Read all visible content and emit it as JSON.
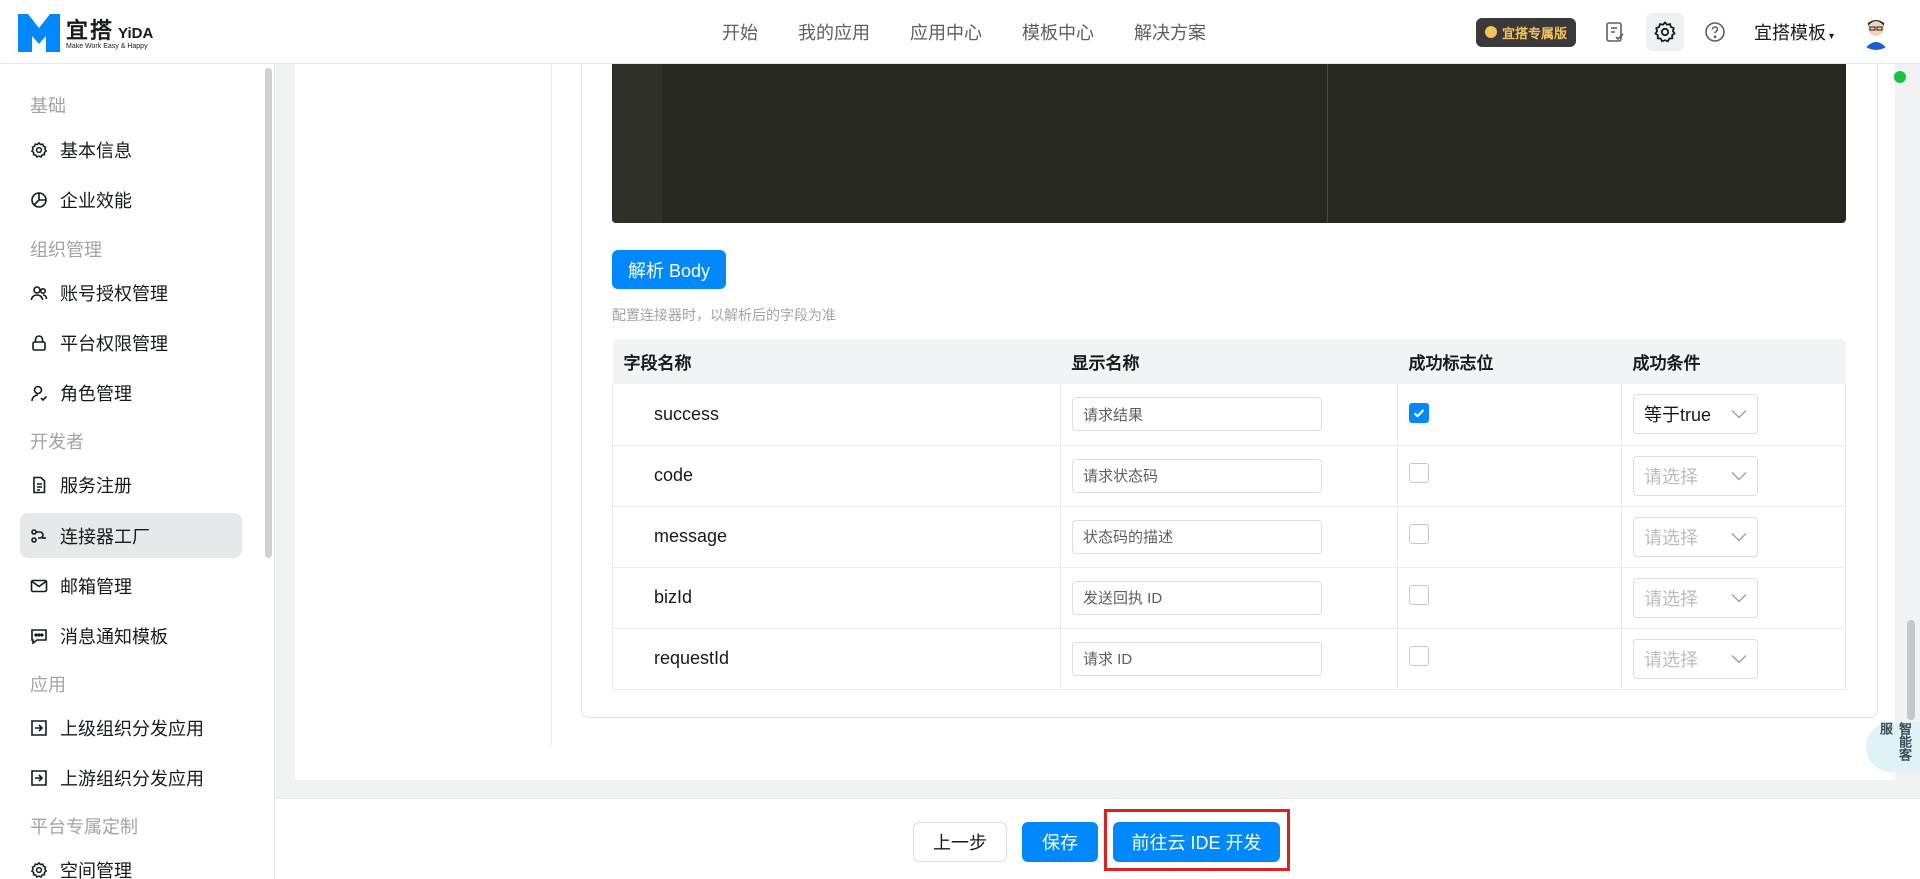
{
  "brand": {
    "name_cn": "宜搭",
    "name_en": "YiDA",
    "tagline": "Make Work Easy & Happy"
  },
  "nav": [
    "开始",
    "我的应用",
    "应用中心",
    "模板中心",
    "解决方案"
  ],
  "header_right": {
    "pro_badge": "宜搭专属版",
    "org_name": "宜搭模板"
  },
  "sidebar": {
    "groups": [
      {
        "title": "基础",
        "items": [
          {
            "label": "基本信息",
            "icon": "gear-icon"
          },
          {
            "label": "企业效能",
            "icon": "pie-chart-icon"
          }
        ]
      },
      {
        "title": "组织管理",
        "items": [
          {
            "label": "账号授权管理",
            "icon": "users-icon"
          },
          {
            "label": "平台权限管理",
            "icon": "lock-icon"
          },
          {
            "label": "角色管理",
            "icon": "user-role-icon"
          }
        ]
      },
      {
        "title": "开发者",
        "items": [
          {
            "label": "服务注册",
            "icon": "document-icon"
          },
          {
            "label": "连接器工厂",
            "icon": "connector-icon"
          },
          {
            "label": "邮箱管理",
            "icon": "mail-icon"
          },
          {
            "label": "消息通知模板",
            "icon": "message-icon"
          }
        ]
      },
      {
        "title": "应用",
        "items": [
          {
            "label": "上级组织分发应用",
            "icon": "enter-icon"
          },
          {
            "label": "上游组织分发应用",
            "icon": "enter-icon"
          }
        ]
      },
      {
        "title": "平台专属定制",
        "items": [
          {
            "label": "空间管理",
            "icon": "gear-icon"
          }
        ]
      }
    ],
    "active": "连接器工厂"
  },
  "content": {
    "parse_button": "解析 Body",
    "tip": "配置连接器时，以解析后的字段为准",
    "table": {
      "headers": [
        "字段名称",
        "显示名称",
        "成功标志位",
        "成功条件"
      ],
      "rows": [
        {
          "field": "success",
          "display": "请求结果",
          "flag": true,
          "condition": "等于true"
        },
        {
          "field": "code",
          "display": "请求状态码",
          "flag": false,
          "condition": "请选择"
        },
        {
          "field": "message",
          "display": "状态码的描述",
          "flag": false,
          "condition": "请选择"
        },
        {
          "field": "bizId",
          "display": "发送回执 ID",
          "flag": false,
          "condition": "请选择"
        },
        {
          "field": "requestId",
          "display": "请求 ID",
          "flag": false,
          "condition": "请选择"
        }
      ]
    }
  },
  "footer": {
    "prev": "上一步",
    "save": "保存",
    "ide": "前往云 IDE 开发"
  },
  "help_bubble": "智能客服",
  "colors": {
    "primary": "#0089ff",
    "highlight": "#e02020",
    "online": "#17c43f"
  }
}
